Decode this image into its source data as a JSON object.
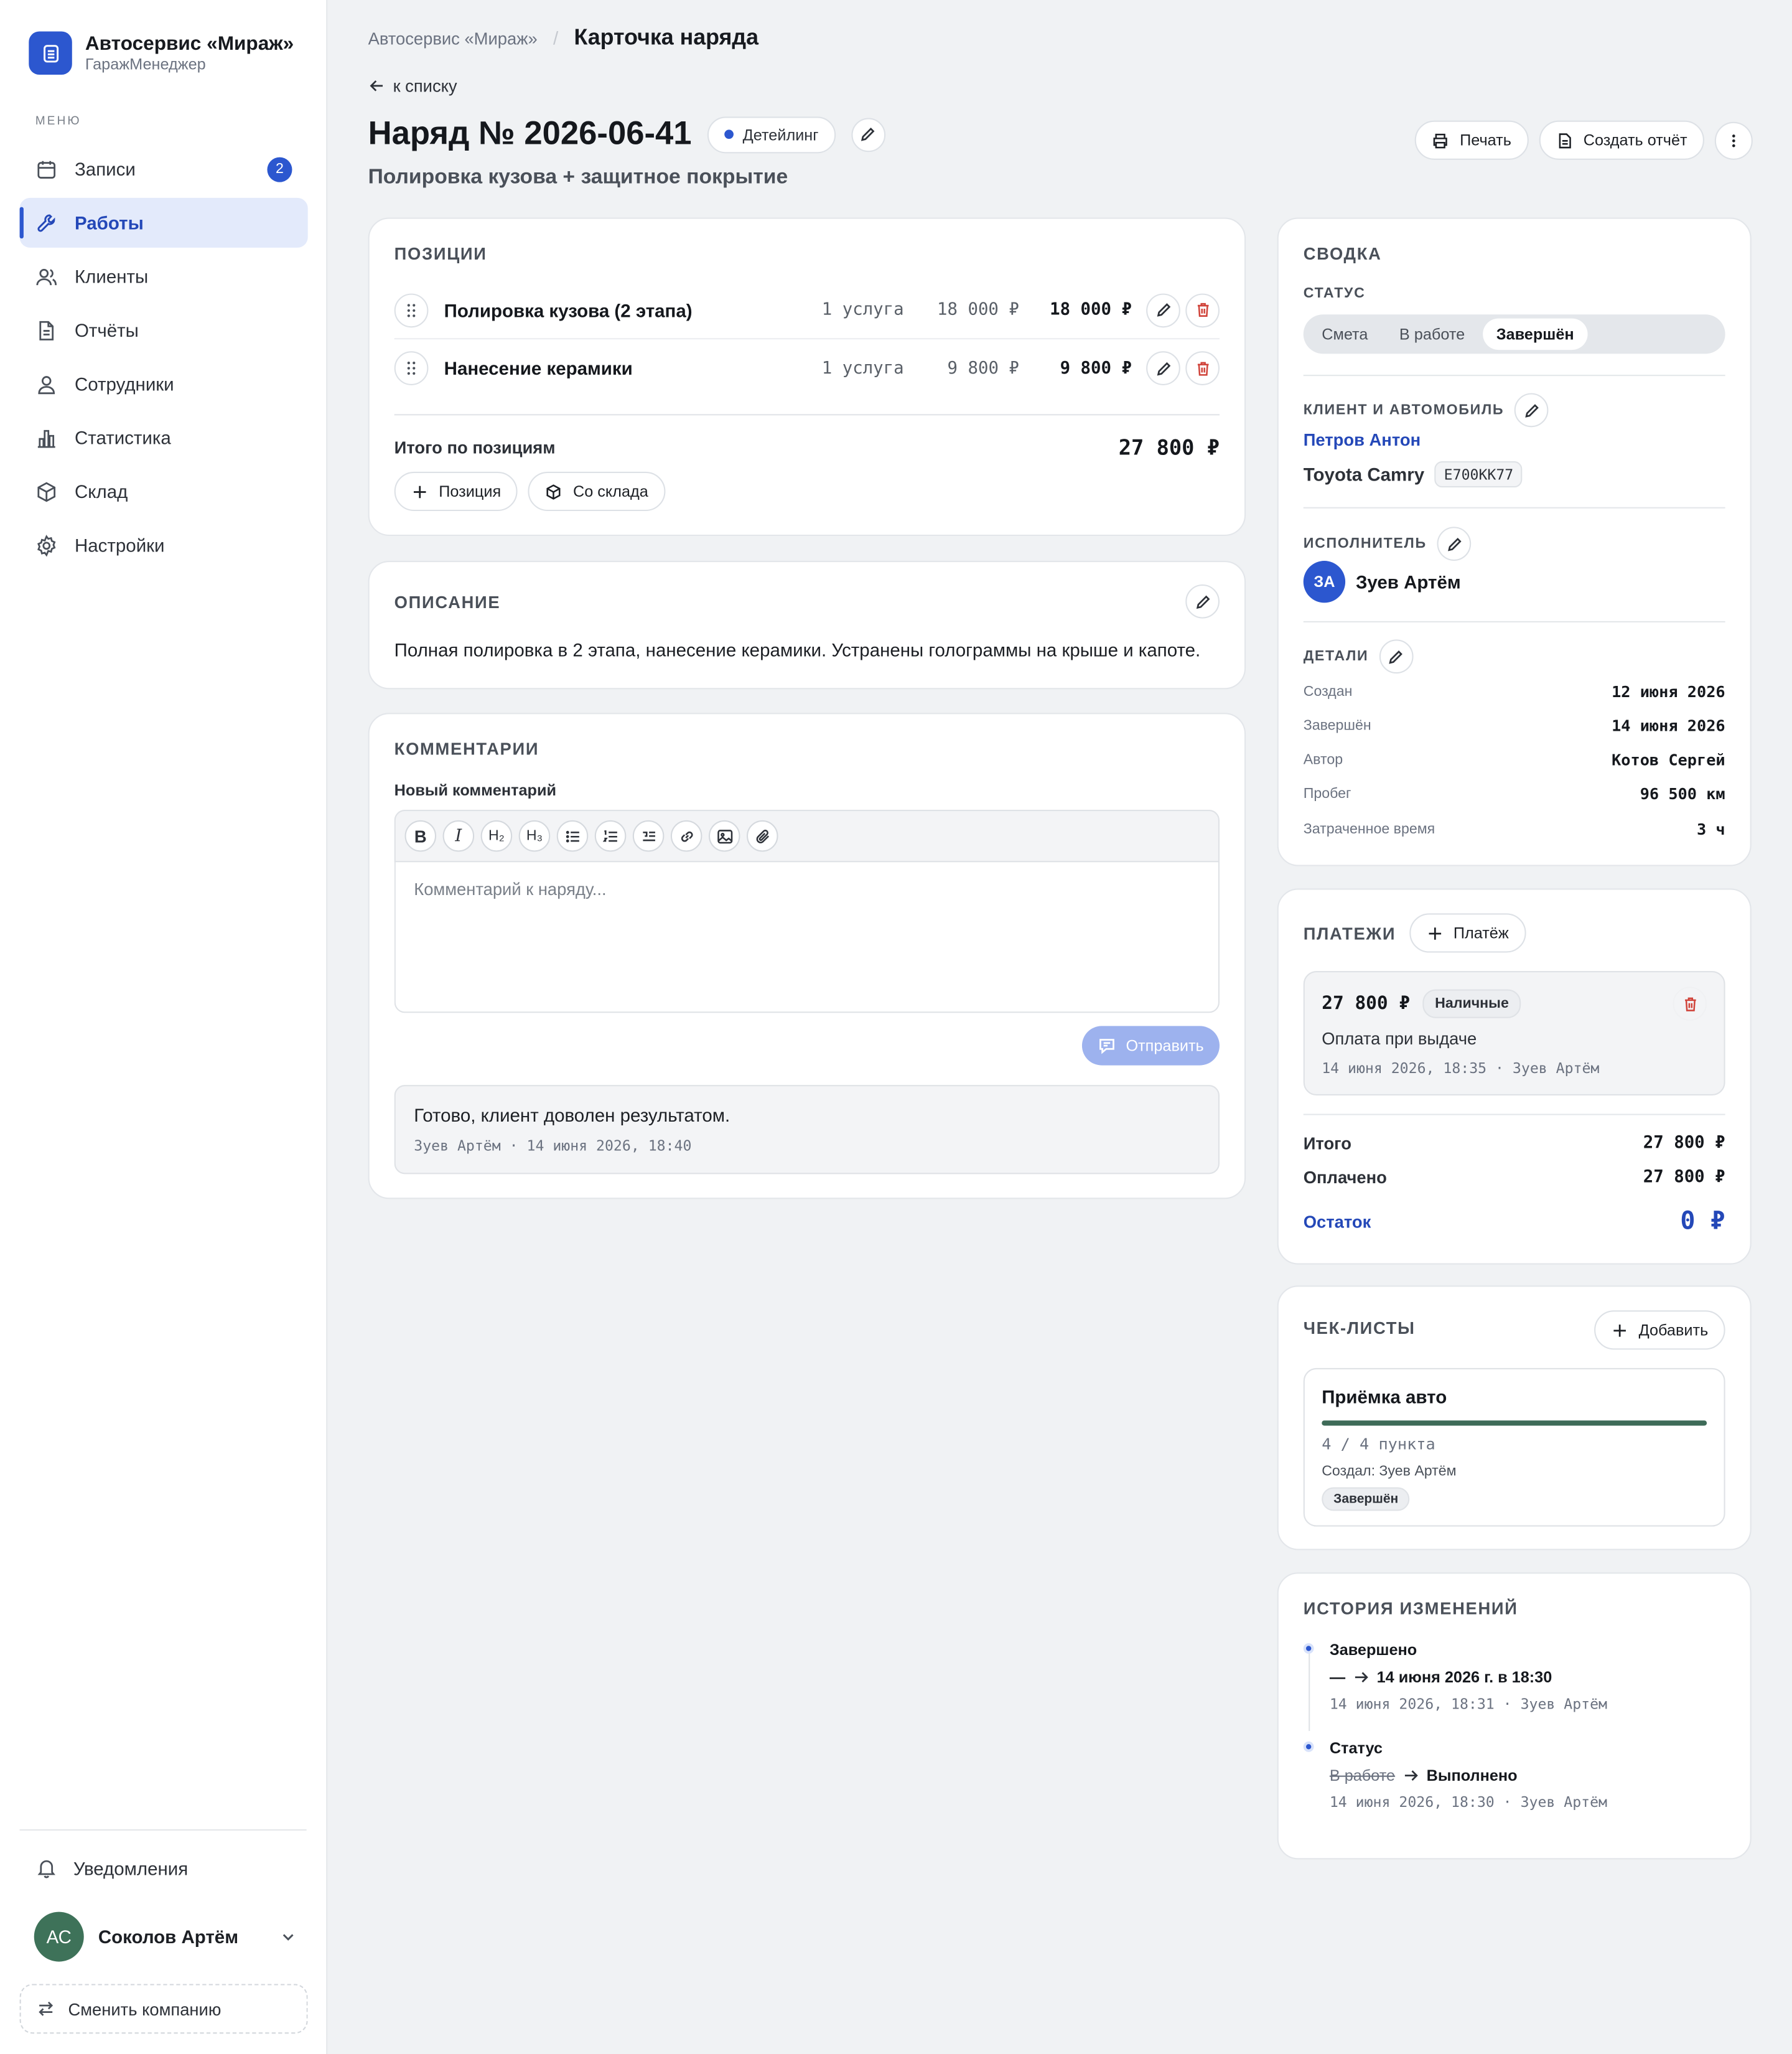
{
  "brand": {
    "title": "Автосервис «Мираж»",
    "subtitle": "ГаражМенеджер"
  },
  "sidebar": {
    "menu_label": "МЕНЮ",
    "items": [
      {
        "label": "Записи",
        "icon": "calendar-icon",
        "badge": "2"
      },
      {
        "label": "Работы",
        "icon": "wrench-icon",
        "active": true
      },
      {
        "label": "Клиенты",
        "icon": "users-icon"
      },
      {
        "label": "Отчёты",
        "icon": "document-icon"
      },
      {
        "label": "Сотрудники",
        "icon": "user-icon"
      },
      {
        "label": "Статистика",
        "icon": "bar-chart-icon"
      },
      {
        "label": "Склад",
        "icon": "box-icon"
      },
      {
        "label": "Настройки",
        "icon": "gear-icon"
      }
    ],
    "notifications": "Уведомления",
    "user": {
      "initials": "АС",
      "name": "Соколов Артём"
    },
    "switch_company": "Сменить компанию"
  },
  "breadcrumb": {
    "parent": "Автосервис «Мираж»",
    "current": "Карточка наряда"
  },
  "back_link": "к списку",
  "order": {
    "title": "Наряд № 2026-06-41",
    "tag": "Детейлинг",
    "subtitle": "Полировка кузова + защитное покрытие"
  },
  "actions": {
    "print": "Печать",
    "report": "Создать отчёт"
  },
  "positions": {
    "title": "ПОЗИЦИИ",
    "rows": [
      {
        "name": "Полировка кузова (2 этапа)",
        "qty": "1 услуга",
        "price": "18 000 ₽",
        "total": "18 000 ₽"
      },
      {
        "name": "Нанесение керамики",
        "qty": "1 услуга",
        "price": "9 800 ₽",
        "total": "9 800 ₽"
      }
    ],
    "total_label": "Итого по позициям",
    "total_value": "27 800 ₽",
    "add_position": "Позиция",
    "from_stock": "Со склада"
  },
  "description": {
    "title": "ОПИСАНИЕ",
    "text": "Полная полировка в 2 этапа, нанесение керамики. Устранены голограммы на крыше и капоте."
  },
  "comments": {
    "title": "КОММЕНТАРИИ",
    "new_label": "Новый комментарий",
    "toolbar": [
      "B",
      "I",
      "H₂",
      "H₃"
    ],
    "placeholder": "Комментарий к наряду...",
    "send": "Отправить",
    "items": [
      {
        "text": "Готово, клиент доволен результатом.",
        "meta": "Зуев Артём · 14 июня 2026, 18:40"
      }
    ]
  },
  "summary": {
    "title": "СВОДКА",
    "status_label": "СТАТУС",
    "statuses": [
      "Смета",
      "В работе",
      "Завершён"
    ],
    "active_status": "Завершён",
    "client_label": "КЛИЕНТ И АВТОМОБИЛЬ",
    "client_name": "Петров Антон",
    "car": "Toyota Camry",
    "plate": "Е700КК77",
    "executor_label": "ИСПОЛНИТЕЛЬ",
    "executor_initials": "ЗА",
    "executor_name": "Зуев Артём",
    "details_label": "ДЕТАЛИ",
    "details": [
      {
        "k": "Создан",
        "v": "12 июня 2026"
      },
      {
        "k": "Завершён",
        "v": "14 июня 2026"
      },
      {
        "k": "Автор",
        "v": "Котов Сергей"
      },
      {
        "k": "Пробег",
        "v": "96 500 км"
      },
      {
        "k": "Затраченное время",
        "v": "3 ч"
      }
    ]
  },
  "payments": {
    "title": "ПЛАТЕЖИ",
    "add": "Платёж",
    "item": {
      "amount": "27 800 ₽",
      "method": "Наличные",
      "note": "Оплата при выдаче",
      "meta": "14 июня 2026, 18:35 · Зуев Артём"
    },
    "total_label": "Итого",
    "total_value": "27 800 ₽",
    "paid_label": "Оплачено",
    "paid_value": "27 800 ₽",
    "rest_label": "Остаток",
    "rest_value": "0 ₽"
  },
  "checklists": {
    "title": "ЧЕК-ЛИСТЫ",
    "add": "Добавить",
    "item": {
      "name": "Приёмка авто",
      "progress": 1.0,
      "count": "4 / 4 пункта",
      "author": "Создал: Зуев Артём",
      "status": "Завершён"
    }
  },
  "history": {
    "title": "ИСТОРИЯ ИЗМЕНЕНИЙ",
    "items": [
      {
        "title": "Завершено",
        "from": "—",
        "to": "14 июня 2026 г. в 18:30",
        "meta": "14 июня 2026, 18:31 · Зуев Артём"
      },
      {
        "title": "Статус",
        "from": "В работе",
        "to": "Выполнено",
        "meta": "14 июня 2026, 18:30 · Зуев Артём"
      }
    ]
  },
  "colors": {
    "accent": "#2c57cf",
    "danger": "#d0433a",
    "progress": "#3e6b58"
  }
}
